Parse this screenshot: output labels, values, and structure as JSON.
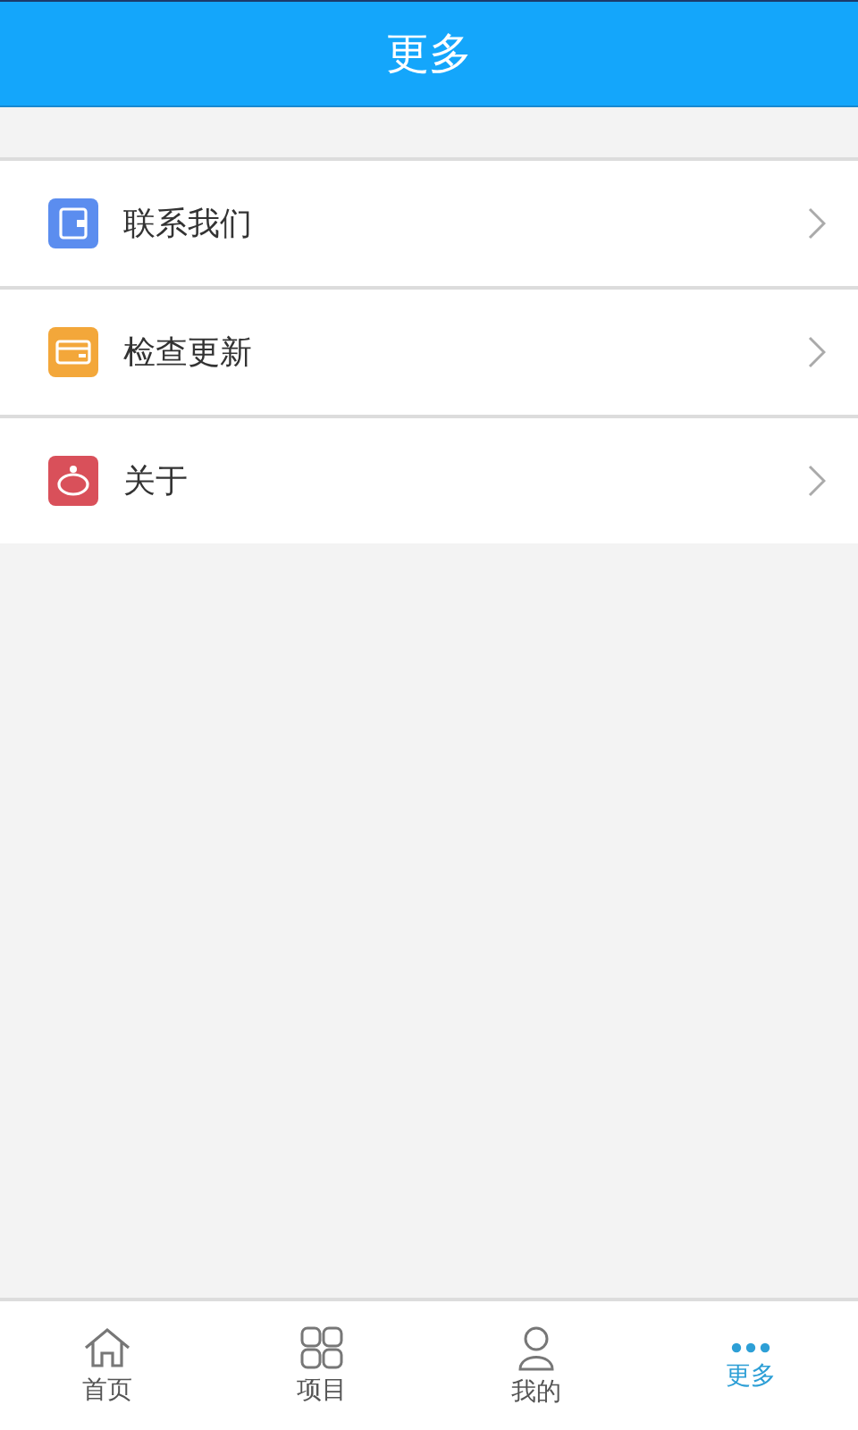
{
  "header": {
    "title": "更多"
  },
  "menu": [
    {
      "label": "联系我们",
      "kind": "wallet",
      "color": "#5b8def"
    },
    {
      "label": "检查更新",
      "kind": "card",
      "color": "#f3a73a"
    },
    {
      "label": "关于",
      "kind": "piggy",
      "color": "#d9505a"
    }
  ],
  "tabs": [
    {
      "label": "首页",
      "kind": "home",
      "selected": false
    },
    {
      "label": "项目",
      "kind": "grid",
      "selected": false
    },
    {
      "label": "我的",
      "kind": "user",
      "selected": false
    },
    {
      "label": "更多",
      "kind": "more",
      "selected": true
    }
  ]
}
